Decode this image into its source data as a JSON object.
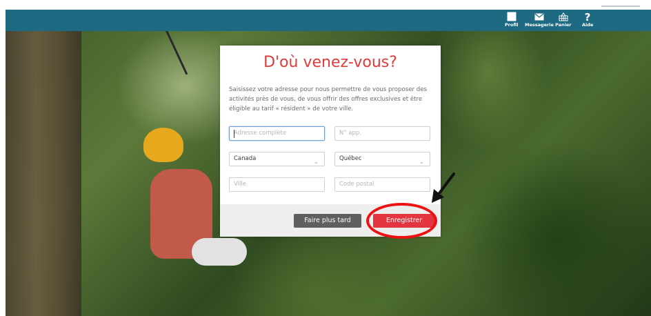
{
  "nav": {
    "items": [
      {
        "label": "Profil",
        "icon": "profile-icon"
      },
      {
        "label": "Messagerie",
        "icon": "envelope-icon"
      },
      {
        "label": "Panier",
        "icon": "basket-icon"
      },
      {
        "label": "Aide",
        "icon": "help-icon"
      }
    ]
  },
  "modal": {
    "title": "D'où venez-vous?",
    "description": "Saisissez votre adresse pour nous permettre de vous proposer des activités près de vous, de vous offrir des offres exclusives et être éligible au tarif « résident » de votre ville.",
    "address_placeholder": "Adresse complète",
    "apt_placeholder": "N° app.",
    "country_value": "Canada",
    "province_value": "Québec",
    "city_placeholder": "Ville",
    "postal_placeholder": "Code postal",
    "later_label": "Faire plus tard",
    "save_label": "Enregistrer"
  },
  "colors": {
    "navbar": "#1e6a83",
    "title": "#e23a3a",
    "save_button": "#e3353f",
    "later_button": "#5f5f5f",
    "annotation": "#ee1111"
  }
}
